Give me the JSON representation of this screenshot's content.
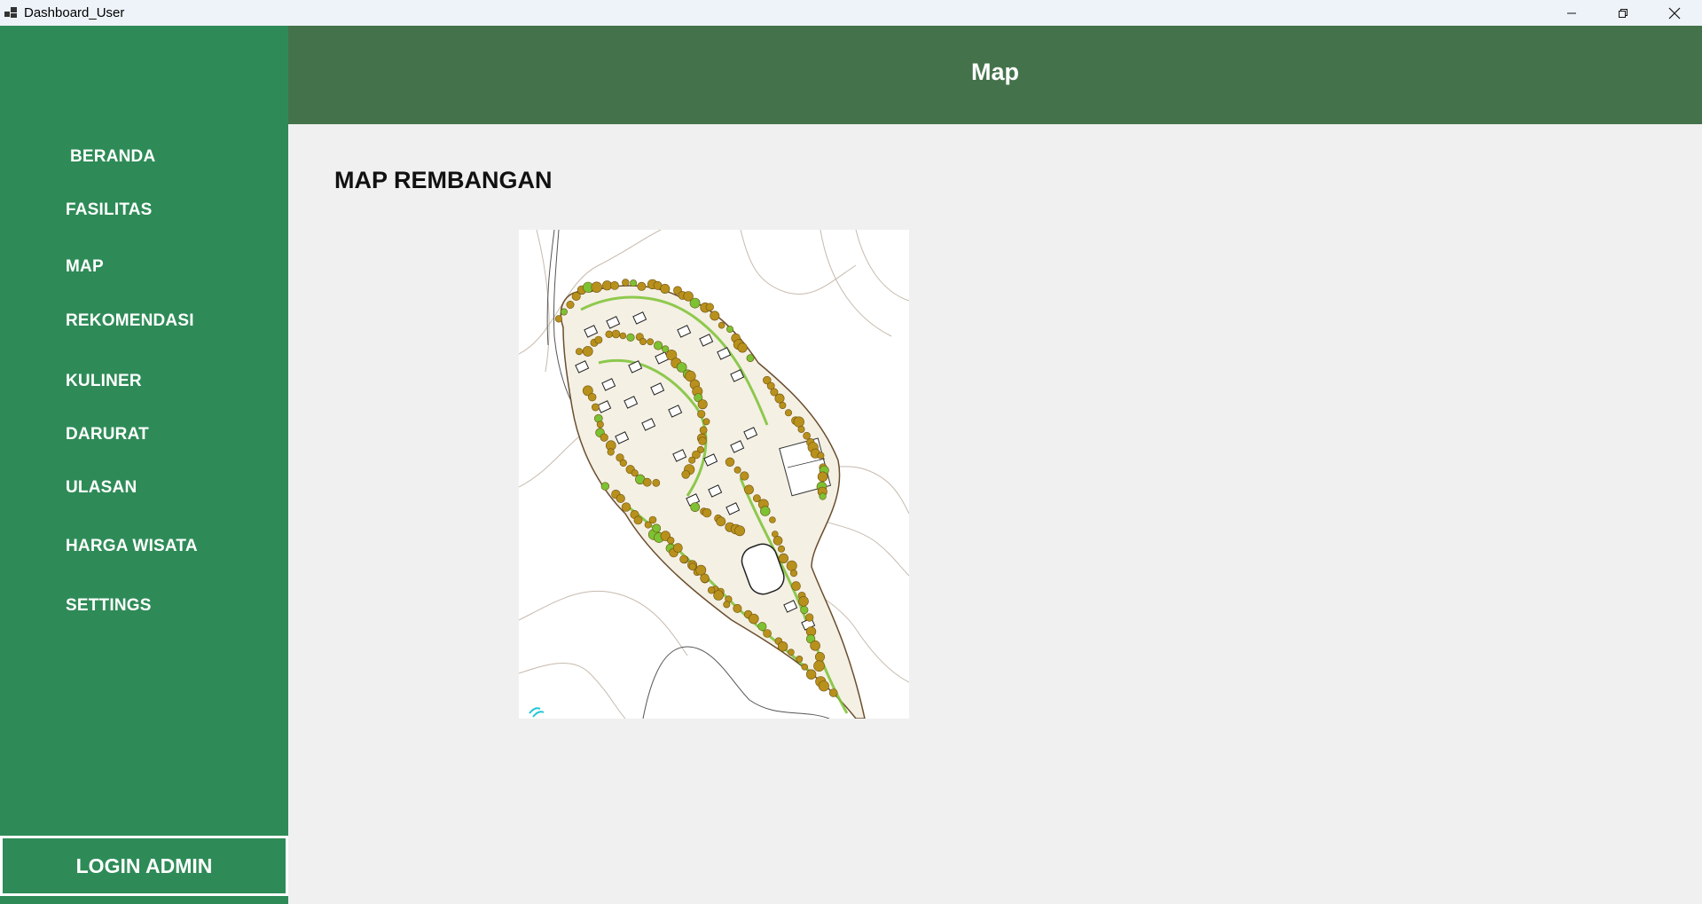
{
  "window": {
    "title": "Dashboard_User",
    "controls": [
      "minimize-icon",
      "restore-icon",
      "close-icon"
    ]
  },
  "sidebar": {
    "items": [
      {
        "label": "BERANDA"
      },
      {
        "label": "FASILITAS"
      },
      {
        "label": "MAP"
      },
      {
        "label": "REKOMENDASI"
      },
      {
        "label": "KULINER"
      },
      {
        "label": "DARURAT"
      },
      {
        "label": "ULASAN"
      },
      {
        "label": "HARGA WISATA"
      },
      {
        "label": "SETTINGS"
      }
    ],
    "login_label": "LOGIN ADMIN"
  },
  "header": {
    "title": "Map"
  },
  "main": {
    "section_title": "MAP REMBANGAN"
  },
  "colors": {
    "sidebar": "#2e8b57",
    "header": "#44734b",
    "background": "#f0f0f0",
    "tree": "#b8901c",
    "greenery": "#7cc233"
  }
}
